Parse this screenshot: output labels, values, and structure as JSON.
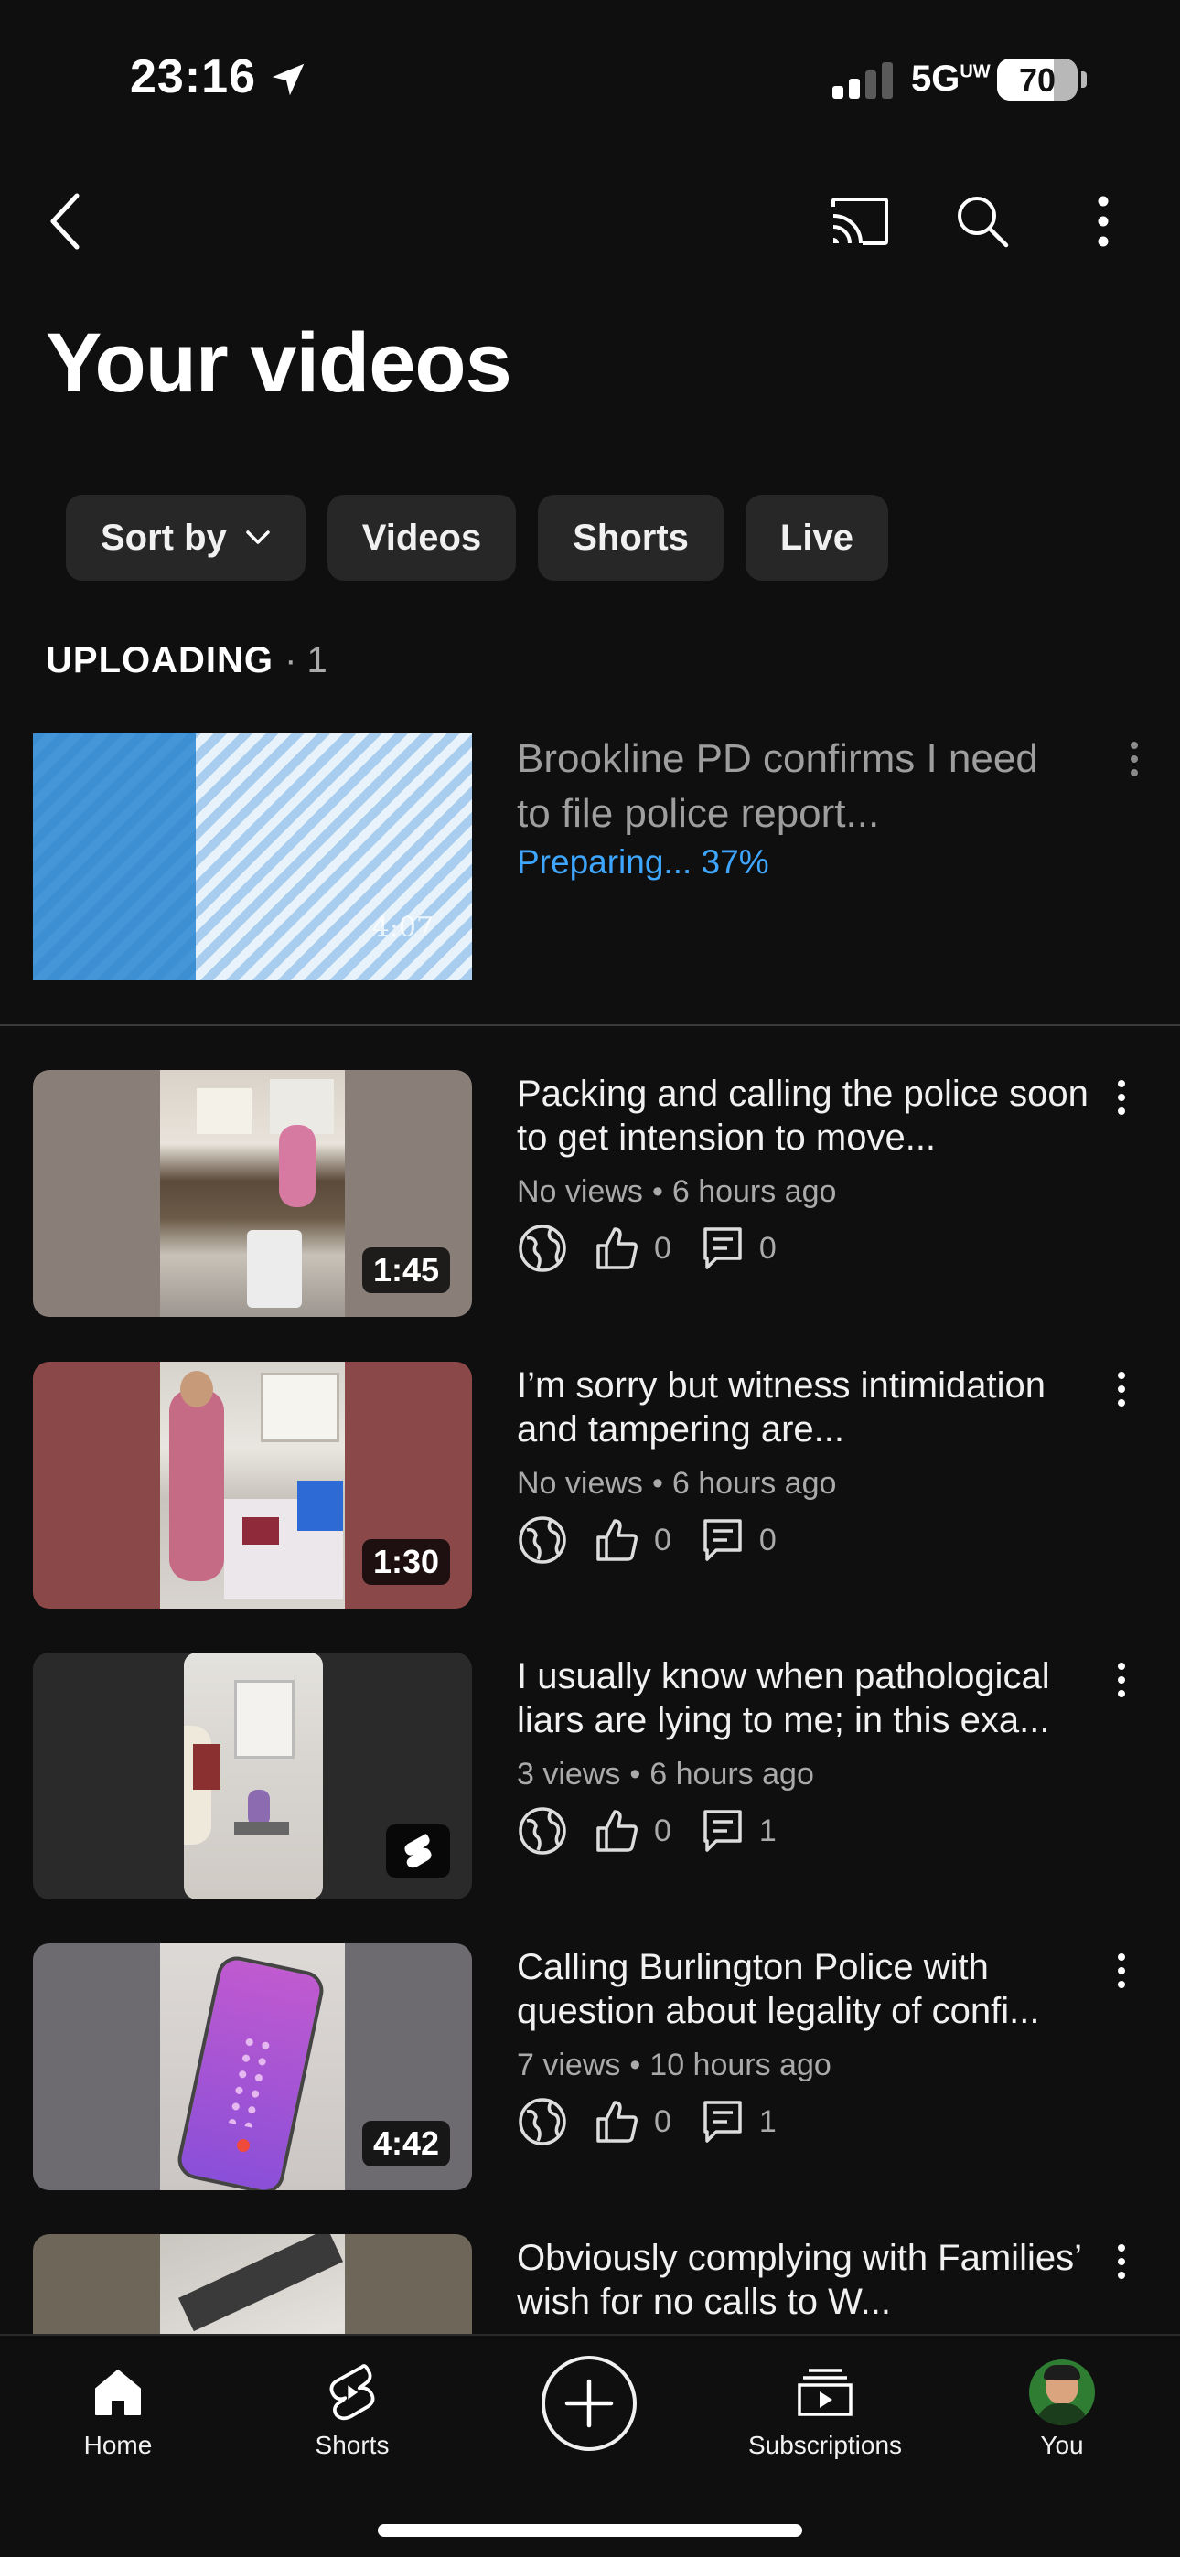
{
  "status_bar": {
    "time": "23:16",
    "network": "5G",
    "network_sup": "UW",
    "battery": "70",
    "battery_level": 0.7
  },
  "top_bar": {
    "icons": [
      "back-icon",
      "cast-icon",
      "search-icon",
      "more-vert-icon"
    ]
  },
  "page_title": "Your videos",
  "filters": {
    "sort_label": "Sort by",
    "chips": [
      "Videos",
      "Shorts",
      "Live"
    ]
  },
  "uploading": {
    "header": "UPLOADING",
    "count": "· 1",
    "item": {
      "title": "Brookline PD confirms I need to file police report...",
      "status": "Preparing... 37%",
      "progress": 0.37,
      "duration": "4:07"
    }
  },
  "videos": [
    {
      "title": "Packing and calling the police soon to get intension to move...",
      "views": "No views",
      "age": "6 hours ago",
      "likes": "0",
      "comments": "0",
      "duration": "1:45",
      "is_short": false,
      "thumb_side_color": "#8a7f78"
    },
    {
      "title": "I’m sorry but witness intimidation  and tampering are...",
      "views": "No views",
      "age": "6 hours ago",
      "likes": "0",
      "comments": "0",
      "duration": "1:30",
      "is_short": false,
      "thumb_side_color": "#8b4848"
    },
    {
      "title": "I usually know when pathological liars are lying to me; in this exa...",
      "views": "3 views",
      "age": "6 hours ago",
      "likes": "0",
      "comments": "1",
      "duration": "",
      "is_short": true,
      "thumb_side_color": "#2a2a2a"
    },
    {
      "title": "Calling Burlington Police with question about legality of confi...",
      "views": "7 views",
      "age": "10 hours ago",
      "likes": "0",
      "comments": "1",
      "duration": "4:42",
      "is_short": false,
      "thumb_side_color": "#6e6b70"
    },
    {
      "title": "Obviously complying with Families’ wish for no calls to W...",
      "views": "",
      "age": "",
      "likes": "",
      "comments": "",
      "duration": "",
      "is_short": false,
      "thumb_side_color": "#6e6659"
    }
  ],
  "bottom_nav": {
    "home": "Home",
    "shorts": "Shorts",
    "subscriptions": "Subscriptions",
    "you": "You"
  },
  "colors": {
    "background": "#0f0f0f",
    "chip": "#272727",
    "accent_blue": "#3ea6ff",
    "secondary_text": "#aaaaaa"
  }
}
